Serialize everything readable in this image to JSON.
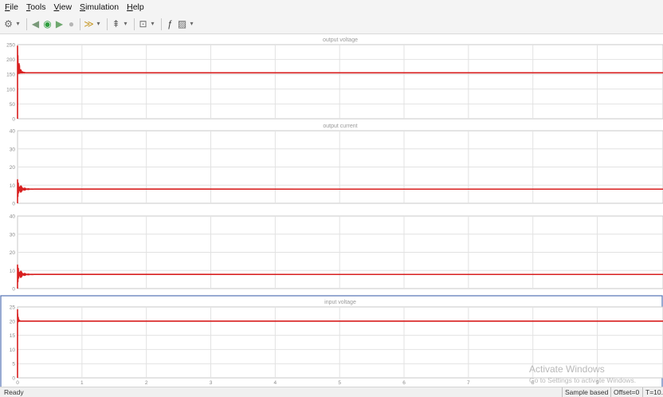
{
  "menu": [
    "File",
    "Tools",
    "View",
    "Simulation",
    "Help"
  ],
  "menu_mnemonics": [
    "F",
    "T",
    "V",
    "S",
    "H"
  ],
  "toolbar": {
    "items": [
      {
        "name": "settings-icon",
        "glyph": "⚙",
        "color": "#666666",
        "dropdown": true
      },
      {
        "name": "step-back-icon",
        "glyph": "◀",
        "color": "#7a9a7a",
        "dropdown": false
      },
      {
        "name": "run-icon",
        "glyph": "◉",
        "color": "#2e9e3e",
        "dropdown": false
      },
      {
        "name": "step-forward-icon",
        "glyph": "▶",
        "color": "#6fa86f",
        "dropdown": false
      },
      {
        "name": "stop-icon",
        "glyph": "●",
        "color": "#b6b6b6",
        "dropdown": false
      },
      {
        "name": "highlight-icon",
        "glyph": "≫",
        "color": "#c89a2a",
        "dropdown": true
      },
      {
        "name": "cursor-icon",
        "glyph": "⇞",
        "color": "#666666",
        "dropdown": true
      },
      {
        "name": "zoom-icon",
        "glyph": "⊡",
        "color": "#666666",
        "dropdown": true
      },
      {
        "name": "autoscale-icon",
        "glyph": "ƒ",
        "color": "#444444",
        "dropdown": false
      },
      {
        "name": "style-icon",
        "glyph": "▨",
        "color": "#666666",
        "dropdown": true
      }
    ]
  },
  "colors": {
    "signal": "#d81f1f",
    "grid": "#e2e2e2",
    "axes": "#c8c8c8",
    "selected_panel": "#5472b4",
    "watermark": "#b9b9b9"
  },
  "chart_data": [
    {
      "type": "line",
      "title": "output voltage",
      "ylim": [
        0,
        250
      ],
      "yticks": [
        "250",
        "200",
        "150",
        "100",
        "50",
        "0"
      ],
      "xlim": [
        0,
        10
      ],
      "grid": true,
      "settled_value": 155,
      "transient": {
        "peak": 245,
        "minimum": 150,
        "settle_time": 0.12
      },
      "selected": false
    },
    {
      "type": "line",
      "title": "output current",
      "ylim": [
        0,
        40
      ],
      "yticks": [
        "40",
        "30",
        "20",
        "10",
        "0"
      ],
      "xlim": [
        0,
        10
      ],
      "grid": true,
      "settled_value": 7.8,
      "transient": {
        "peak": 13,
        "minimum": 3,
        "settle_time": 0.25
      },
      "selected": false
    },
    {
      "type": "line",
      "title": "",
      "ylim": [
        0,
        40
      ],
      "yticks": [
        "40",
        "30",
        "20",
        "10",
        "0"
      ],
      "xlim": [
        0,
        10
      ],
      "grid": true,
      "settled_value": 7.8,
      "transient": {
        "peak": 13,
        "minimum": 3,
        "settle_time": 0.25
      },
      "selected": false
    },
    {
      "type": "line",
      "title": "input voltage",
      "ylim": [
        0,
        25
      ],
      "yticks": [
        "25",
        "20",
        "15",
        "10",
        "5",
        "0"
      ],
      "xlim": [
        0,
        10
      ],
      "xticks": [
        "0",
        "1",
        "2",
        "3",
        "4",
        "5",
        "6",
        "7",
        "8",
        "9"
      ],
      "grid": true,
      "settled_value": 20,
      "transient": {
        "peak": 24,
        "minimum": 19.4,
        "settle_time": 0.05
      },
      "selected": true
    }
  ],
  "watermark": {
    "line1": "Activate Windows",
    "line2": "Go to Settings to activate Windows."
  },
  "status": {
    "ready": "Ready",
    "sample_mode": "Sample based",
    "offset": "Offset=0",
    "time": "T=10.0"
  }
}
